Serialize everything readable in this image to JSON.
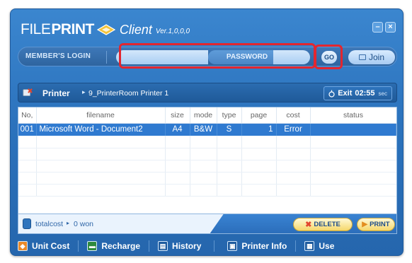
{
  "app": {
    "brand_file": "FILE",
    "brand_print": "PRINT",
    "client": "Client",
    "version": "Ver.1,0,0,0",
    "minimize": "–",
    "close": "×"
  },
  "login": {
    "member_label": "MEMBER'S LOGIN",
    "password_label": "PASSWORD",
    "go_label": "GO",
    "join_label": "Join"
  },
  "printer": {
    "label": "Printer",
    "name": "9_PrinterRoom Printer 1",
    "exit_label": "Exit",
    "exit_time": "02:55",
    "exit_unit": "sec"
  },
  "table": {
    "columns": [
      "No,",
      "filename",
      "size",
      "mode",
      "type",
      "page",
      "cost",
      "status"
    ],
    "rows": [
      {
        "no": "001",
        "filename": "Microsoft Word - Document2",
        "size": "A4",
        "mode": "B&W",
        "type": "S",
        "page": "1",
        "cost": "Error",
        "status": ""
      }
    ]
  },
  "footer": {
    "total_label": "totalcost",
    "total_value": "0 won",
    "delete_label": "DELETE",
    "print_label": "PRINT"
  },
  "menu": {
    "items": [
      {
        "label": "Unit Cost",
        "icon": "unit-cost-icon"
      },
      {
        "label": "Recharge",
        "icon": "recharge-icon"
      },
      {
        "label": "History",
        "icon": "history-icon"
      },
      {
        "label": "Printer Info",
        "icon": "printer-info-icon"
      },
      {
        "label": "Use",
        "icon": "use-icon"
      }
    ]
  },
  "colors": {
    "window": "#2c73bd",
    "selection": "#2f7ad0",
    "highlight": "#e3262f"
  }
}
